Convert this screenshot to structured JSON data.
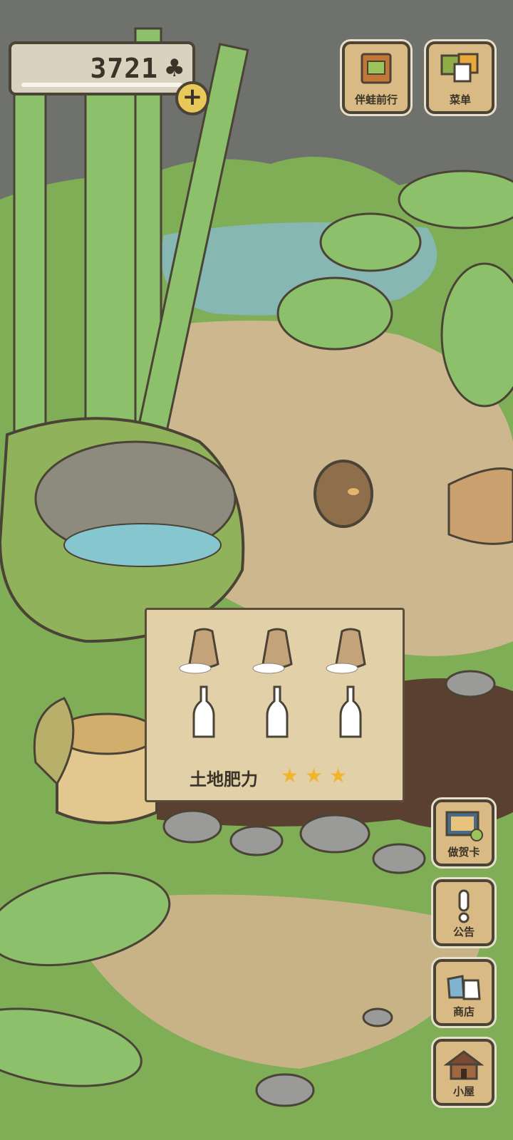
{
  "hud": {
    "clover_count": "3721",
    "add_symbol": "+"
  },
  "top_buttons": [
    {
      "label": "伴蛙前行",
      "icon": "travel-book-icon"
    },
    {
      "label": "菜单",
      "icon": "menu-cards-icon"
    }
  ],
  "side_buttons": [
    {
      "label": "做贺卡",
      "icon": "postcard-icon"
    },
    {
      "label": "公告",
      "icon": "exclamation-icon"
    },
    {
      "label": "商店",
      "icon": "shop-bags-icon"
    },
    {
      "label": "小屋",
      "icon": "house-icon"
    }
  ],
  "garden_panel": {
    "row1": [
      "rice-sack-icon",
      "rice-sack-icon",
      "rice-sack-icon"
    ],
    "row2": [
      "bottle-icon",
      "bottle-icon",
      "bottle-icon"
    ],
    "fertility_label": "土地肥力",
    "fertility_stars": 3,
    "fertility_max": 3
  },
  "colors": {
    "grass": "#7fae56",
    "path": "#cdb78e",
    "wood": "#d9b984",
    "outline": "#4a4336",
    "star": "#f1b52c"
  }
}
